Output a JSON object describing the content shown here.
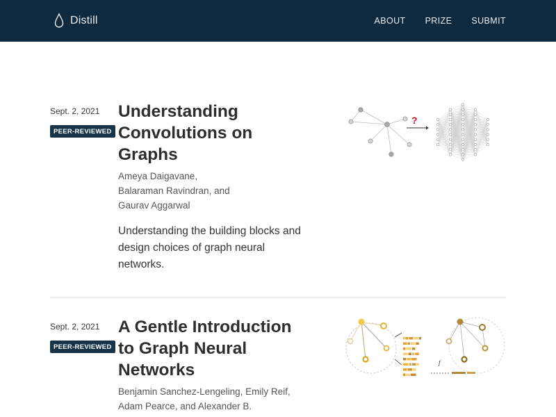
{
  "header": {
    "brand": "Distill",
    "brand_icon": "droplet-icon",
    "nav": [
      "ABOUT",
      "PRIZE",
      "SUBMIT"
    ],
    "bg_color": "#0f2a3e"
  },
  "posts": [
    {
      "date": "Sept. 2, 2021",
      "badge": "PEER-REVIEWED",
      "title": "Understanding Convolutions on Graphs",
      "authors": [
        "Ameya Daigavane,",
        "Balaraman Ravindran, and",
        "Gaurav Aggarwal"
      ],
      "description": "Understanding the building blocks and design choices of graph neural networks.",
      "thumbnail": {
        "question_mark": "?"
      }
    },
    {
      "date": "Sept. 2, 2021",
      "badge": "PEER-REVIEWED",
      "title": "A Gentle Introduction to Graph Neural Networks",
      "authors": [
        "Benjamin Sanchez-Lengeling, Emily Reif,",
        "Adam Pearce, and Alexander B."
      ],
      "description": "",
      "thumbnail": {
        "f_label": "f"
      }
    }
  ]
}
